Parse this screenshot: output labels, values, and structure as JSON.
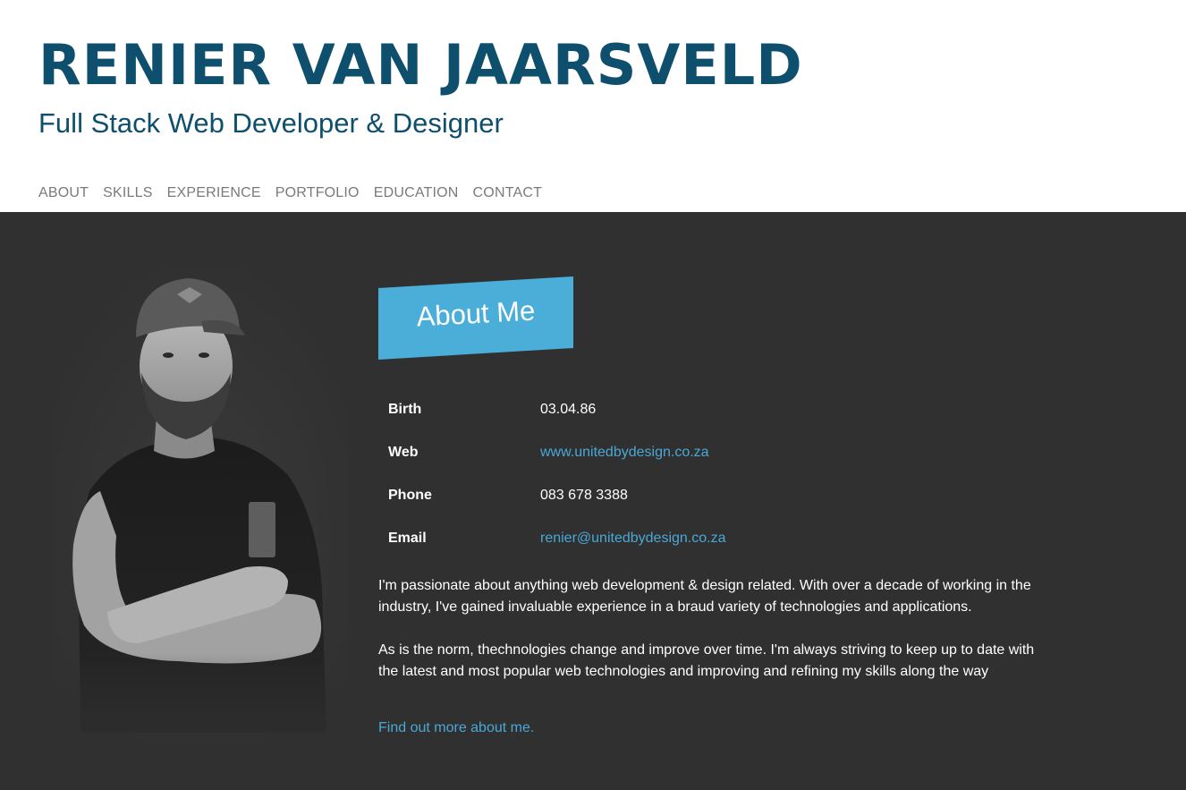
{
  "header": {
    "name": "RENIER VAN JAARSVELD",
    "subtitle": "Full Stack Web Developer & Designer"
  },
  "nav": {
    "items": [
      {
        "label": "ABOUT"
      },
      {
        "label": "SKILLS"
      },
      {
        "label": "EXPERIENCE"
      },
      {
        "label": "PORTFOLIO"
      },
      {
        "label": "EDUCATION"
      },
      {
        "label": "CONTACT"
      }
    ]
  },
  "about": {
    "title": "About Me",
    "title_bg_color": "#4aaed8",
    "info": [
      {
        "label": "Birth",
        "value": "03.04.86"
      },
      {
        "label": "Web",
        "value": "www.unitedbydesign.co.za"
      },
      {
        "label": "Phone",
        "value": "083 678 3388"
      },
      {
        "label": "Email",
        "value": "renier@unitedbydesign.co.za"
      }
    ],
    "bio": [
      "I'm passionate about anything web development & design related. With over a decade of working in the industry, I've gained invaluable experience in a braud variety of technologies and applications.",
      "As is the norm, thechnologies change and improve over time. I'm always striving to keep up to date with the latest and most popular web technologies and improving and refining my skills along the way"
    ],
    "more_link": "Find out more about me."
  },
  "colors": {
    "brand": "#0d4f6c",
    "accent": "#4aa8d6",
    "section_bg": "#303030",
    "nav_text": "#7a7a7a"
  }
}
